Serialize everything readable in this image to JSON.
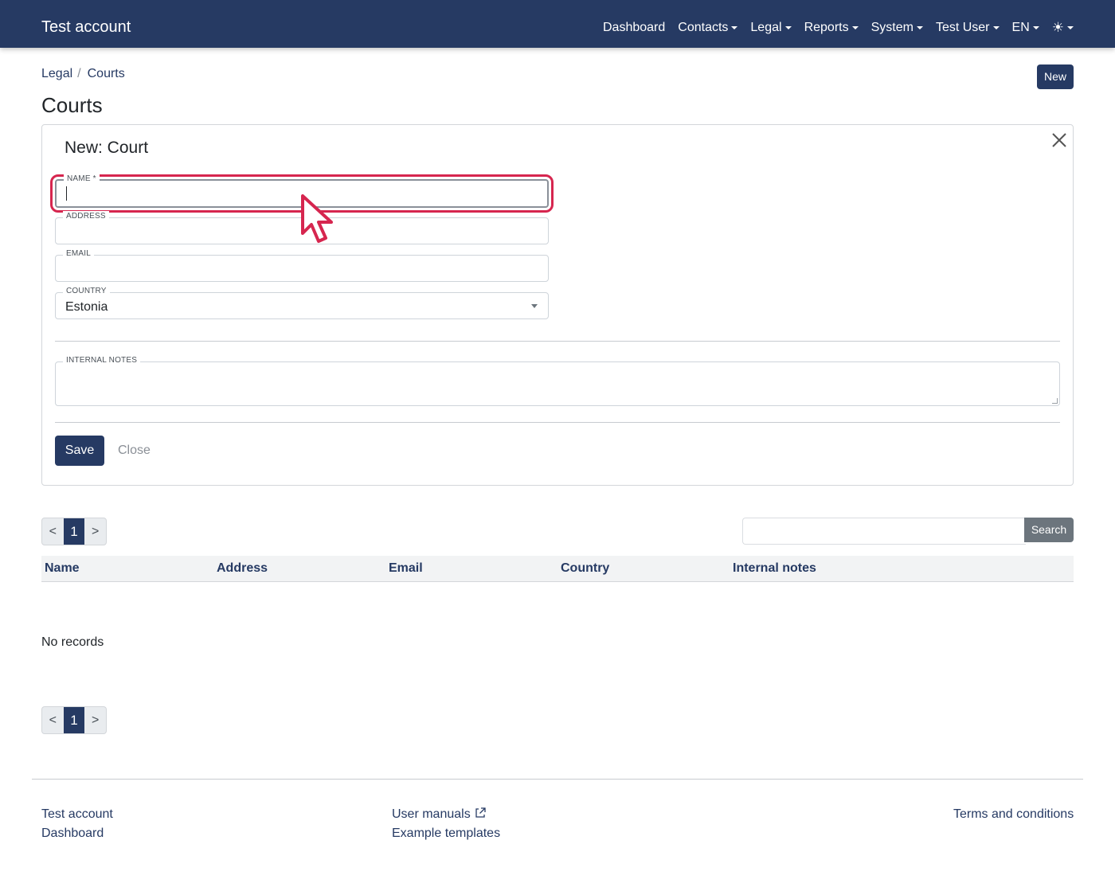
{
  "navbar": {
    "brand": "Test account",
    "items": [
      {
        "label": "Dashboard",
        "dropdown": false
      },
      {
        "label": "Contacts",
        "dropdown": true
      },
      {
        "label": "Legal",
        "dropdown": true
      },
      {
        "label": "Reports",
        "dropdown": true
      },
      {
        "label": "System",
        "dropdown": true
      },
      {
        "label": "Test User",
        "dropdown": true
      },
      {
        "label": "EN",
        "dropdown": true
      }
    ],
    "theme_icon": "☀"
  },
  "breadcrumb": {
    "parent": "Legal",
    "separator": "/",
    "current": "Courts"
  },
  "new_button": "New",
  "page_title": "Courts",
  "form": {
    "title": "New: Court",
    "fields": {
      "name": {
        "label": "NAME *",
        "value": ""
      },
      "address": {
        "label": "ADDRESS",
        "value": ""
      },
      "email": {
        "label": "EMAIL",
        "value": ""
      },
      "country": {
        "label": "COUNTRY",
        "value": "Estonia"
      },
      "notes": {
        "label": "INTERNAL NOTES",
        "value": ""
      }
    },
    "save_label": "Save",
    "close_label": "Close"
  },
  "pagination": {
    "prev": "<",
    "current": "1",
    "next": ">"
  },
  "search": {
    "button": "Search",
    "value": ""
  },
  "table": {
    "columns": [
      "Name",
      "Address",
      "Email",
      "Country",
      "Internal notes"
    ],
    "empty_text": "No records"
  },
  "footer": {
    "col1": [
      "Test account",
      "Dashboard"
    ],
    "col2": [
      "User manuals",
      "Example templates"
    ],
    "col3": [
      "Terms and conditions"
    ]
  },
  "colors": {
    "primary": "#263a63",
    "focus_highlight": "#d6264f",
    "search_button": "#6c757d"
  }
}
